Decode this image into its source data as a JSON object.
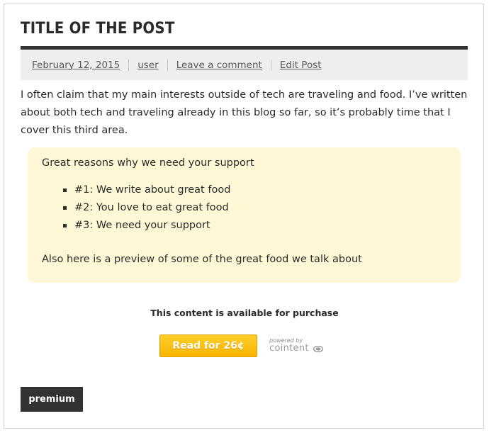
{
  "post": {
    "title": "TITLE OF THE POST",
    "meta": {
      "date": "February 12, 2015",
      "author": "user",
      "comment_link": "Leave a comment",
      "edit_link": "Edit Post"
    },
    "intro": "I often claim that my main interests outside of tech are traveling and food. I’ve written about both tech and traveling already in this blog so far, so it’s probably time that I cover this third area."
  },
  "support_box": {
    "heading": "Great reasons why we need your support",
    "reasons": [
      "#1: We write about great food",
      "#2: You love to eat great food",
      "#3: We need your support"
    ],
    "preview": "Also here is a preview of some of the great food we talk about",
    "background": "#fff8d6"
  },
  "purchase": {
    "note": "This content is available for purchase",
    "button_label": "Read for 26¢",
    "powered_by": "powered by",
    "brand": "cointent",
    "brand_icon": "cointent-logo-icon",
    "button_color": "#f8b400"
  },
  "tag": {
    "label": "premium"
  },
  "colors": {
    "text": "#2b2b2b",
    "meta_bar": "#eeeeee",
    "meta_border": "#333333"
  }
}
